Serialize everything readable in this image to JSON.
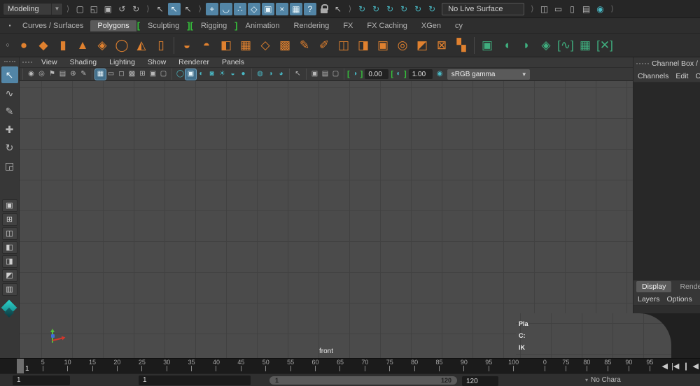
{
  "colors": {
    "accent_blue": "#5285a6",
    "shelf_orange": "#e0812f",
    "teal": "#49b8c4",
    "bracket_green": "#35c13b",
    "viewport_bg": "#4b4b4b",
    "grid_line": "#414141"
  },
  "topbar": {
    "menuset_label": "Modeling",
    "file_tools": [
      {
        "name": "new-scene-icon",
        "g": "▢"
      },
      {
        "name": "open-scene-icon",
        "g": "◱"
      },
      {
        "name": "save-scene-icon",
        "g": "▣"
      },
      {
        "name": "undo-icon",
        "g": "↺"
      },
      {
        "name": "redo-icon",
        "g": "↻"
      }
    ],
    "selection_masks": [
      {
        "name": "select-hierarchy-icon",
        "g": "↖"
      },
      {
        "name": "select-object-icon",
        "g": "↖",
        "a": true
      },
      {
        "name": "select-component-icon",
        "g": "↖"
      }
    ],
    "snap_tools": [
      {
        "name": "snap-to-grid-icon",
        "g": "+",
        "a": true,
        "c": "c-teal"
      },
      {
        "name": "snap-to-curves-icon",
        "g": "◡",
        "a": true,
        "c": "c-teal"
      },
      {
        "name": "snap-to-points-icon",
        "g": "∴",
        "a": true,
        "c": "c-teal"
      },
      {
        "name": "snap-to-projected-center-icon",
        "g": "◇",
        "a": true,
        "c": "c-teal"
      },
      {
        "name": "snap-to-view-planes-icon",
        "g": "▣",
        "a": true,
        "c": "c-teal"
      },
      {
        "name": "make-live-icon",
        "g": "×",
        "a": true,
        "c": "c-teal"
      },
      {
        "name": "snap-together-icon",
        "g": "▦",
        "a": true,
        "c": "c-teal"
      },
      {
        "name": "snap-help-icon",
        "g": "?",
        "a": true,
        "c": "c-teal"
      }
    ],
    "lock_icon_name": "lock-selection-icon",
    "select_by_input_icon_name": "highlight-selection-mode-icon",
    "history_tools": [
      {
        "name": "construction-history-icon-1",
        "g": "↻",
        "c": "c-teal"
      },
      {
        "name": "construction-history-icon-2",
        "g": "↻",
        "c": "c-teal"
      },
      {
        "name": "construction-history-icon-3",
        "g": "↻",
        "c": "c-teal"
      },
      {
        "name": "construction-history-icon-4",
        "g": "↻",
        "c": "c-teal"
      },
      {
        "name": "construction-history-icon-5",
        "g": "↻",
        "c": "c-teal"
      },
      {
        "name": "construction-history-icon-6",
        "g": "↻",
        "c": "c-teal"
      }
    ],
    "live_surface_value": "No Live Surface",
    "render_tools": [
      {
        "name": "render-view-icon",
        "g": "◫"
      },
      {
        "name": "render-current-frame-icon",
        "g": "▭"
      },
      {
        "name": "ipr-render-icon",
        "g": "▯"
      },
      {
        "name": "render-settings-icon",
        "g": "▤"
      },
      {
        "name": "render-setup-icon",
        "g": "◉",
        "c": "c-teal"
      }
    ]
  },
  "shelf_tabs": {
    "menu_icon_name": "shelf-tab-menu-icon",
    "items": [
      {
        "label": "Curves / Surfaces",
        "name": "tab-curves-surfaces"
      },
      {
        "label": "Polygons",
        "name": "tab-polygons",
        "active": true
      },
      {
        "bracket": "["
      },
      {
        "label": "Sculpting",
        "name": "tab-sculpting"
      },
      {
        "bracket": "]["
      },
      {
        "label": "Rigging",
        "name": "tab-rigging"
      },
      {
        "bracket": "]"
      },
      {
        "label": "Animation",
        "name": "tab-animation"
      },
      {
        "label": "Rendering",
        "name": "tab-rendering"
      },
      {
        "label": "FX",
        "name": "tab-fx"
      },
      {
        "label": "FX Caching",
        "name": "tab-fx-caching"
      },
      {
        "label": "XGen",
        "name": "tab-xgen"
      },
      {
        "label": "cy",
        "name": "tab-cy"
      }
    ]
  },
  "shelf": {
    "options_icon_name": "shelf-options-icon",
    "icons": [
      {
        "name": "poly-sphere-icon",
        "g": "●",
        "c": "c-orange"
      },
      {
        "name": "poly-cube-icon",
        "g": "◆",
        "c": "c-orange"
      },
      {
        "name": "poly-cylinder-icon",
        "g": "▮",
        "c": "c-orange"
      },
      {
        "name": "poly-cone-icon",
        "g": "▲",
        "c": "c-orange"
      },
      {
        "name": "poly-plane-icon",
        "g": "◈",
        "c": "c-orange"
      },
      {
        "name": "poly-torus-icon",
        "g": "◯",
        "c": "c-orange"
      },
      {
        "name": "poly-pyramid-icon",
        "g": "◭",
        "c": "c-orange"
      },
      {
        "name": "poly-pipe-icon",
        "g": "▯",
        "c": "c-orange"
      },
      {
        "sep": true
      },
      {
        "name": "combine-icon",
        "g": "◒",
        "c": "c-orange"
      },
      {
        "name": "separate-icon",
        "g": "◓",
        "c": "c-orange"
      },
      {
        "name": "boolean-icon",
        "g": "◧",
        "c": "c-orange"
      },
      {
        "name": "fill-hole-icon",
        "g": "▦",
        "c": "c-orange"
      },
      {
        "name": "smooth-icon",
        "g": "◇",
        "c": "c-orange"
      },
      {
        "name": "subdivide-icon",
        "g": "▩",
        "c": "c-orange"
      },
      {
        "name": "create-polygon-tool-icon",
        "g": "✎",
        "c": "c-orange"
      },
      {
        "name": "multi-cut-icon",
        "g": "✐",
        "c": "c-orange"
      },
      {
        "name": "extrude-icon",
        "g": "◫",
        "c": "c-orange"
      },
      {
        "name": "mirror-icon",
        "g": "◨",
        "c": "c-orange"
      },
      {
        "name": "bridge-icon",
        "g": "▣",
        "c": "c-orange"
      },
      {
        "name": "circularize-icon",
        "g": "◎",
        "c": "c-orange"
      },
      {
        "name": "quad-draw-icon",
        "g": "◩",
        "c": "c-orange"
      },
      {
        "name": "target-weld-icon",
        "g": "⊠",
        "c": "c-orange"
      },
      {
        "name": "reduce-icon",
        "g": "▚",
        "c": "c-orange"
      },
      {
        "sep": true
      },
      {
        "name": "uv-planar-icon",
        "g": "▣",
        "c": "c-green"
      },
      {
        "name": "uv-cylindrical-icon",
        "g": "◖",
        "c": "c-green"
      },
      {
        "name": "uv-spherical-icon",
        "g": "◗",
        "c": "c-green"
      },
      {
        "name": "uv-automatic-icon",
        "g": "◈",
        "c": "c-green"
      },
      {
        "name": "uv-contour-stretch-icon",
        "g": "[∿]",
        "c": "c-green"
      },
      {
        "name": "uv-layout-icon",
        "g": "▦",
        "c": "c-green"
      },
      {
        "name": "uv-cut-sew-icon",
        "g": "[✕]",
        "c": "c-green"
      }
    ]
  },
  "panel_menu": {
    "items": [
      {
        "name": "menu-view",
        "label": "View"
      },
      {
        "name": "menu-shading",
        "label": "Shading"
      },
      {
        "name": "menu-lighting",
        "label": "Lighting"
      },
      {
        "name": "menu-show",
        "label": "Show"
      },
      {
        "name": "menu-renderer",
        "label": "Renderer"
      },
      {
        "name": "menu-panels",
        "label": "Panels"
      }
    ]
  },
  "vp_toolbar": {
    "group_cam": [
      {
        "name": "select-camera-icon",
        "g": "◉"
      },
      {
        "name": "camera-attributes-icon",
        "g": "◎"
      },
      {
        "name": "bookmark-icon",
        "g": "⚑"
      },
      {
        "name": "image-plane-icon",
        "g": "▤"
      },
      {
        "name": "two-d-pan-zoom-icon",
        "g": "⊕"
      },
      {
        "name": "grease-pencil-icon",
        "g": "✎"
      }
    ],
    "group_gates": [
      {
        "name": "grid-toggle-icon",
        "g": "▦",
        "a": true
      },
      {
        "name": "film-gate-icon",
        "g": "▭"
      },
      {
        "name": "resolution-gate-icon",
        "g": "◻"
      },
      {
        "name": "gate-mask-icon",
        "g": "▩"
      },
      {
        "name": "field-chart-icon",
        "g": "⊞"
      },
      {
        "name": "safe-action-icon",
        "g": "▣"
      },
      {
        "name": "safe-title-icon",
        "g": "▢"
      }
    ],
    "group_shading": [
      {
        "name": "wireframe-icon",
        "g": "◯",
        "c": "c-teal"
      },
      {
        "name": "shaded-icon",
        "g": "▣",
        "a": true
      },
      {
        "name": "wireframe-on-shaded-icon",
        "g": "◐",
        "c": "c-teal"
      },
      {
        "name": "textured-icon",
        "g": "◙",
        "c": "c-teal"
      },
      {
        "name": "use-all-lights-icon",
        "g": "☀",
        "c": "c-teal"
      },
      {
        "name": "shadows-icon",
        "g": "◒",
        "c": "c-teal"
      },
      {
        "name": "screen-space-ao-icon",
        "g": "●",
        "c": "c-teal"
      }
    ],
    "group_xray": [
      {
        "name": "xray-icon",
        "g": "◍",
        "c": "c-teal"
      },
      {
        "name": "xray-joints-icon",
        "g": "◑",
        "c": "c-teal"
      },
      {
        "name": "xray-active-components-icon",
        "g": "◕",
        "c": "c-teal"
      }
    ],
    "group_isolate": [
      {
        "name": "isolate-select-icon",
        "g": "↖"
      }
    ],
    "group_misc": [
      {
        "name": "panel-option-icon-1",
        "g": "▣"
      },
      {
        "name": "panel-option-icon-2",
        "g": "▤"
      },
      {
        "name": "panel-option-icon-3",
        "g": "▢"
      }
    ],
    "exposure_icon_name": "exposure-icon",
    "exposure_value": "0.00",
    "contrast_icon_name": "contrast-icon",
    "contrast_value": "1.00",
    "color_mgmt_icon_name": "color-management-icon",
    "gamma_value": "sRGB gamma"
  },
  "toolbox": {
    "tools": [
      {
        "name": "select-tool-icon",
        "g": "↖",
        "a": true
      },
      {
        "name": "lasso-tool-icon",
        "g": "∿"
      },
      {
        "name": "paint-select-tool-icon",
        "g": "✎"
      },
      {
        "name": "move-tool-icon",
        "g": "✚"
      },
      {
        "name": "rotate-tool-icon",
        "g": "↻"
      },
      {
        "name": "scale-tool-icon",
        "g": "◲"
      }
    ],
    "layouts": [
      {
        "name": "layout-single-pane-icon",
        "g": "▣"
      },
      {
        "name": "layout-four-view-icon",
        "g": "⊞"
      },
      {
        "name": "layout-persp-outliner-icon",
        "g": "◫"
      },
      {
        "name": "layout-persp-graph-icon",
        "g": "◧"
      },
      {
        "name": "layout-hypershade-icon",
        "g": "◨"
      },
      {
        "name": "layout-uv-editor-icon",
        "g": "◩"
      },
      {
        "name": "layout-custom-icon",
        "g": "▥"
      }
    ],
    "logo_name": "maya-logo-icon"
  },
  "viewport": {
    "camera_label": "front"
  },
  "overlay_window": {
    "hud_labels": [
      "Pla",
      "C:",
      "IK"
    ]
  },
  "channel_box": {
    "title": "Channel Box / Lay",
    "menus": [
      {
        "name": "menu-channels",
        "label": "Channels"
      },
      {
        "name": "menu-edit",
        "label": "Edit"
      },
      {
        "name": "menu-object",
        "label": "O"
      }
    ],
    "bottom_tabs": [
      {
        "name": "tab-display",
        "label": "Display",
        "active": true
      },
      {
        "name": "tab-render",
        "label": "Render"
      }
    ],
    "bottom_menus": [
      {
        "name": "menu-layers",
        "label": "Layers"
      },
      {
        "name": "menu-options",
        "label": "Options"
      }
    ]
  },
  "timeline": {
    "current_frame": "1",
    "ticks_main": [
      "5",
      "10",
      "15",
      "20",
      "25",
      "30",
      "35",
      "40",
      "45",
      "50",
      "55",
      "60",
      "65",
      "70",
      "75",
      "80",
      "85",
      "90",
      "95",
      "100"
    ],
    "ticks_overlay": [
      "0",
      "75",
      "80",
      "85",
      "90",
      "95"
    ],
    "playback_controls": [
      {
        "name": "go-to-start-button",
        "g": "◀"
      },
      {
        "name": "step-back-frame-button",
        "g": "|◀"
      },
      {
        "name": "step-back-key-button",
        "g": "❙",
        "c": "c-key"
      },
      {
        "name": "play-backwards-button",
        "g": "◀"
      }
    ]
  },
  "range_bar": {
    "animation_start": "1",
    "playback_start": "1",
    "slider_start_label": "1",
    "slider_end_label": "120",
    "playback_end": "120",
    "character_set": "No Chara"
  }
}
